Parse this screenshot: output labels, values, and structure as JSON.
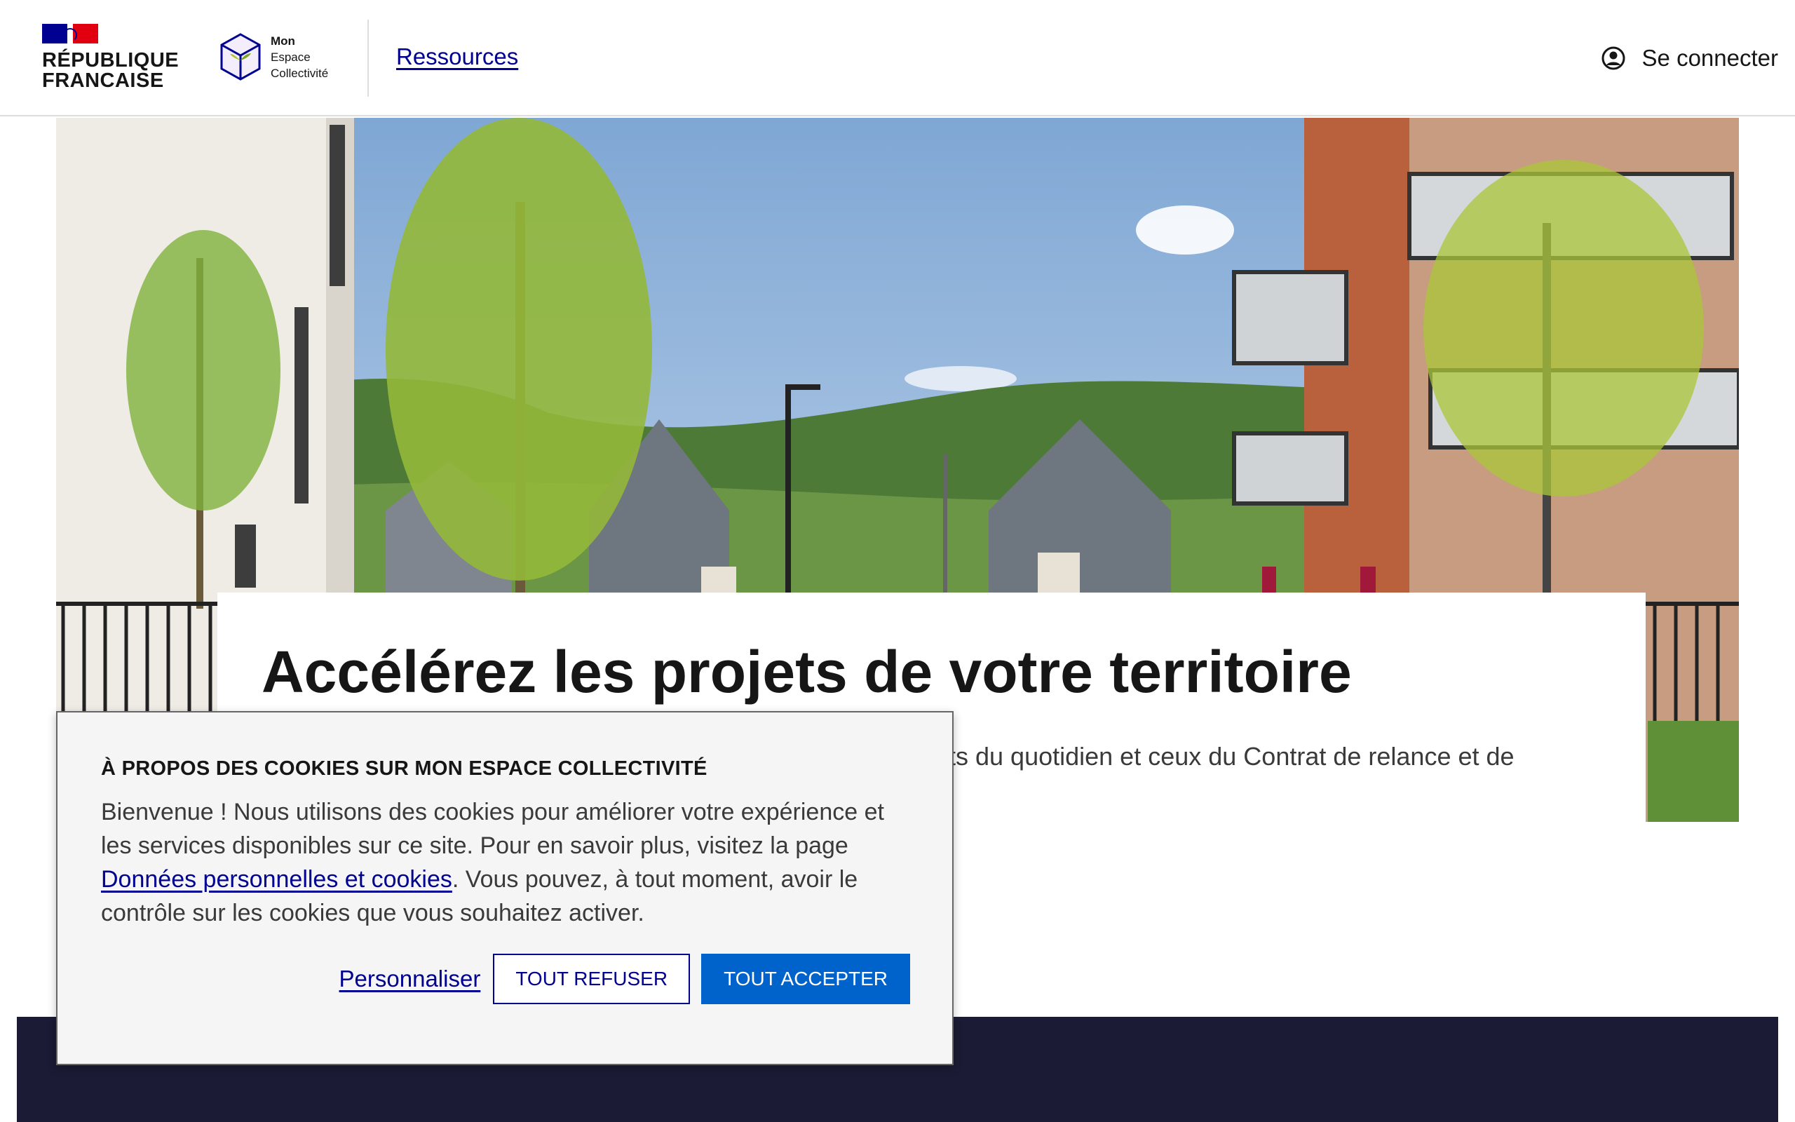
{
  "header": {
    "republique_line1": "RÉPUBLIQUE",
    "republique_line2": "FRANCAISE",
    "brand_lines": [
      "Mon",
      "Espace",
      "Collectivité"
    ],
    "brand_icon": "cube-seedling-icon",
    "nav_link": "Ressources",
    "login_label": "Se connecter",
    "login_icon": "user-circle-icon"
  },
  "hero": {
    "title": "Accélérez les projets de votre territoire",
    "subtitle_visible_fragment": "ts du quotidien et ceux du Contrat de relance et de"
  },
  "cookie_dialog": {
    "title": "À PROPOS DES COOKIES SUR MON ESPACE COLLECTIVITÉ",
    "body_before_link": "Bienvenue ! Nous utilisons des cookies pour améliorer votre expérience et les services disponibles sur ce site. Pour en savoir plus, visitez la page ",
    "link_text": "Données personnelles et cookies",
    "body_after_link": ". Vous pouvez, à tout moment, avoir le contrôle sur les cookies que vous souhaitez activer.",
    "customize_label": "Personnaliser",
    "refuse_label": "TOUT REFUSER",
    "accept_label": "TOUT ACCEPTER"
  },
  "colors": {
    "primary_blue": "#000091",
    "action_blue": "#0063cb",
    "flag_red": "#e1000f",
    "footer_dark": "#1b1b35"
  }
}
